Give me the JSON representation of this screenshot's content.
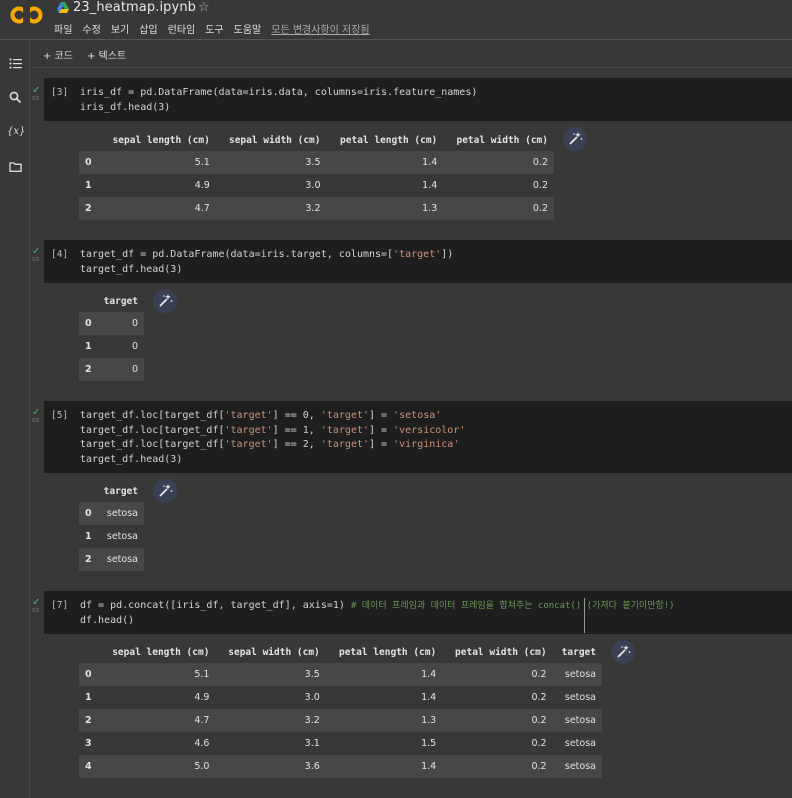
{
  "header": {
    "title": "23_heatmap.ipynb",
    "menu": [
      "파일",
      "수정",
      "보기",
      "삽입",
      "런타임",
      "도구",
      "도움말"
    ],
    "saved_status": "모든 변경사항이 저장됨"
  },
  "toolbar": {
    "add_code": "+ 코드",
    "add_text": "+ 텍스트"
  },
  "cells": [
    {
      "exec": "[3]",
      "lines": [
        "iris_df = pd.DataFrame(data=iris.data, columns=iris.feature_names)",
        "iris_df.head(3)"
      ],
      "output": {
        "columns": [
          "sepal length (cm)",
          "sepal width (cm)",
          "petal length (cm)",
          "petal width (cm)"
        ],
        "rows": [
          [
            "0",
            "5.1",
            "3.5",
            "1.4",
            "0.2"
          ],
          [
            "1",
            "4.9",
            "3.0",
            "1.4",
            "0.2"
          ],
          [
            "2",
            "4.7",
            "3.2",
            "1.3",
            "0.2"
          ]
        ]
      }
    },
    {
      "exec": "[4]",
      "lines": [
        "target_df = pd.DataFrame(data=iris.target, columns=['target'])",
        "target_df.head(3)"
      ],
      "output": {
        "columns": [
          "target"
        ],
        "rows": [
          [
            "0",
            "0"
          ],
          [
            "1",
            "0"
          ],
          [
            "2",
            "0"
          ]
        ]
      }
    },
    {
      "exec": "[5]",
      "lines": [
        "target_df.loc[target_df['target'] == 0, 'target'] = 'setosa'",
        "target_df.loc[target_df['target'] == 1, 'target'] = 'versicolor'",
        "target_df.loc[target_df['target'] == 2, 'target'] = 'virginica'",
        "target_df.head(3)"
      ],
      "output": {
        "columns": [
          "target"
        ],
        "rows": [
          [
            "0",
            "setosa"
          ],
          [
            "1",
            "setosa"
          ],
          [
            "2",
            "setosa"
          ]
        ]
      }
    },
    {
      "exec": "[7]",
      "lines": [
        "df = pd.concat([iris_df, target_df], axis=1) # 데이터 프레임과 데이터 프레임을 합쳐주는 concat() (가져다 붙기이만함!)",
        "df.head()"
      ],
      "output": {
        "columns": [
          "sepal length (cm)",
          "sepal width (cm)",
          "petal length (cm)",
          "petal width (cm)",
          "target"
        ],
        "rows": [
          [
            "0",
            "5.1",
            "3.5",
            "1.4",
            "0.2",
            "setosa"
          ],
          [
            "1",
            "4.9",
            "3.0",
            "1.4",
            "0.2",
            "setosa"
          ],
          [
            "2",
            "4.7",
            "3.2",
            "1.3",
            "0.2",
            "setosa"
          ],
          [
            "3",
            "4.6",
            "3.1",
            "1.5",
            "0.2",
            "setosa"
          ],
          [
            "4",
            "5.0",
            "3.6",
            "1.4",
            "0.2",
            "setosa"
          ]
        ]
      }
    }
  ],
  "icons": {
    "sidebar": [
      "toc-icon",
      "search-icon",
      "variables-icon",
      "folder-icon"
    ],
    "cell_status": "check-icon",
    "output_action": "magic-wand-icon"
  },
  "colors": {
    "accent_orange": "#f9ab00",
    "code_bg": "#1e1e1e",
    "string": "#ce9178",
    "comment": "#6a9955",
    "check": "#3ec16b"
  }
}
